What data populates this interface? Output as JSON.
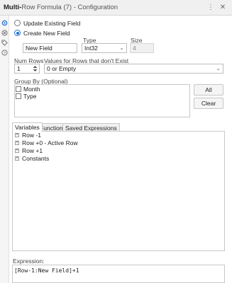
{
  "window": {
    "title_tool": "Multi-",
    "title_rest": "Row Formula (7) - Configuration",
    "pin_glyph": "⋮",
    "close_glyph": "✕"
  },
  "mode": {
    "update_label": "Update Existing Field",
    "create_label": "Create New  Field",
    "selected": "create"
  },
  "new_field": {
    "name_value": "New Field",
    "type_label": "Type",
    "type_value": "Int32",
    "size_label": "Size",
    "size_value": "4"
  },
  "rows": {
    "num_rows_label": "Num Rows",
    "num_rows_value": "1",
    "missing_label": "Values for Rows that don't Exist",
    "missing_value": "0 or Empty"
  },
  "group_by": {
    "label": "Group By (Optional)",
    "items": [
      "Month",
      "Type"
    ],
    "all_label": "All",
    "clear_label": "Clear"
  },
  "tabs": [
    "Variables",
    "Functions",
    "Saved Expressions"
  ],
  "active_tab": "Variables",
  "variables_tree": [
    "Row -1",
    "Row +0 - Active Row",
    "Row +1",
    "Constants"
  ],
  "expression": {
    "label": "Expression:",
    "text": "[Row-1:New Field]+1"
  },
  "colors": {
    "accent": "#1f6fd1",
    "chrome": "#f0f0f0"
  }
}
